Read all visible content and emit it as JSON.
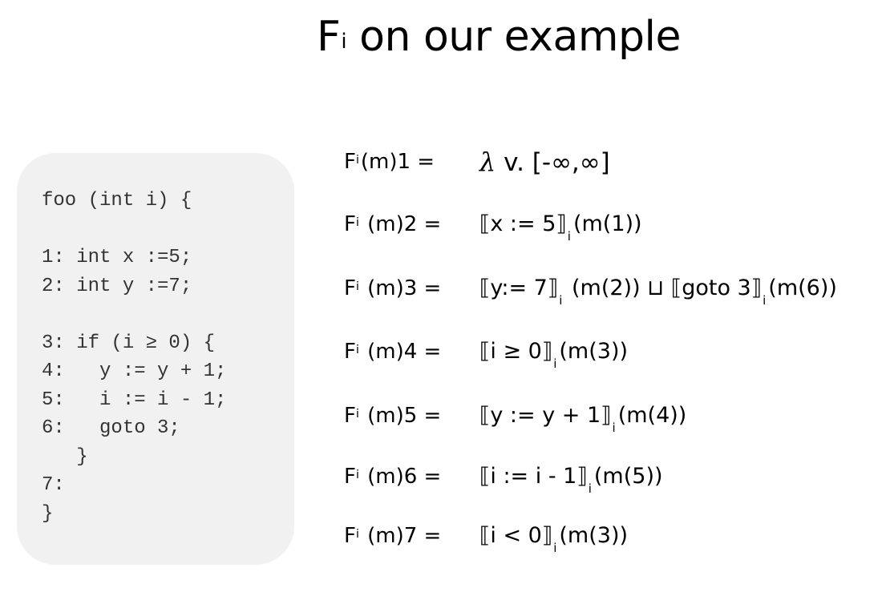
{
  "slide": {
    "title_main": "F",
    "title_sup": "i",
    "title_rest": " on our example"
  },
  "code": [
    "foo (int i) {",
    "",
    "1: int x :=5;",
    "2: int y :=7;",
    "",
    "3: if (i ≥ 0) {",
    "4:   y := y + 1;",
    "5:   i := i - 1;",
    "6:   goto 3;",
    "   }",
    "7:",
    "}"
  ],
  "equations": [
    {
      "lhs_f": "F",
      "lhs_sup": "i",
      "lhs_rest": "(m)1 =",
      "rhs": [
        {
          "t": "λ",
          "c": "lam"
        },
        {
          "t": " v. [-∞,∞]",
          "c": "big"
        }
      ]
    },
    {
      "lhs_f": "F",
      "lhs_sup": "i",
      "lhs_rest": " (m)2 =",
      "rhs": [
        {
          "t": "⟦x := 5⟧"
        },
        {
          "t": "i",
          "c": "sub"
        },
        {
          "t": "(m(1))"
        }
      ]
    },
    {
      "lhs_f": "F",
      "lhs_sup": "i",
      "lhs_rest": " (m)3 =",
      "rhs": [
        {
          "t": "⟦y:= 7⟧"
        },
        {
          "t": "i",
          "c": "sub"
        },
        {
          "t": " (m(2))  ⊔  ⟦goto 3⟧"
        },
        {
          "t": "i",
          "c": "sub"
        },
        {
          "t": "(m(6))"
        }
      ]
    },
    {
      "lhs_f": "F",
      "lhs_sup": "i",
      "lhs_rest": " (m)4 =",
      "rhs": [
        {
          "t": " ⟦i ≥ 0⟧"
        },
        {
          "t": "i",
          "c": "sub"
        },
        {
          "t": "(m(3))"
        }
      ]
    },
    {
      "lhs_f": "F",
      "lhs_sup": "i",
      "lhs_rest": " (m)5 =",
      "rhs": [
        {
          "t": "⟦y := y + 1⟧"
        },
        {
          "t": "i",
          "c": "sub"
        },
        {
          "t": "(m(4))"
        }
      ]
    },
    {
      "lhs_f": "F",
      "lhs_sup": "i",
      "lhs_rest": " (m)6 =",
      "rhs": [
        {
          "t": "⟦i := i - 1⟧"
        },
        {
          "t": "i",
          "c": "sub"
        },
        {
          "t": "(m(5))"
        }
      ]
    },
    {
      "lhs_f": "F",
      "lhs_sup": "i",
      "lhs_rest": " (m)7 =",
      "rhs": [
        {
          "t": "⟦i < 0⟧"
        },
        {
          "t": "i",
          "c": "sub"
        },
        {
          "t": "(m(3))"
        }
      ]
    }
  ]
}
